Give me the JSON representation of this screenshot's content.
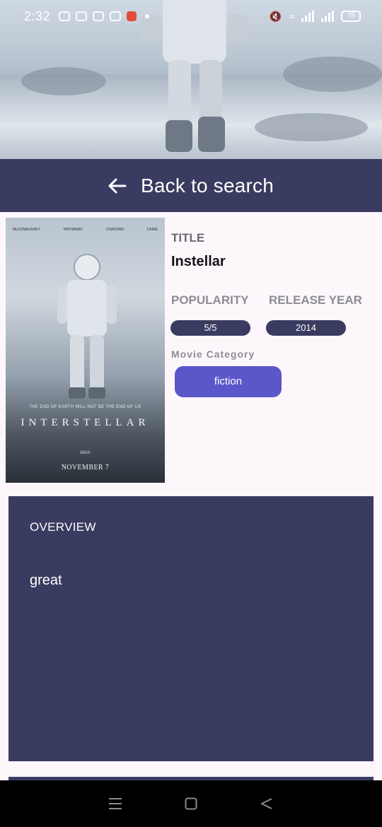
{
  "status_bar": {
    "time": "2:32",
    "battery": "78"
  },
  "header": {
    "back_label": "Back to search"
  },
  "poster": {
    "credits": [
      "McCONAUGHEY",
      "HATHAWAY",
      "CHASTAIN",
      "CAINE"
    ],
    "tagline": "THE END OF EARTH WILL NOT BE THE END OF US",
    "title": "INTERSTELLAR",
    "imax_line": "IMAX",
    "date": "NOVEMBER 7"
  },
  "details": {
    "title_label": "TITLE",
    "title_value": "Instellar",
    "popularity_label": "POPULARITY",
    "popularity_value": "5/5",
    "release_year_label": "RELEASE YEAR",
    "release_year_value": "2014",
    "category_label": "Movie Category",
    "category_value": "fiction"
  },
  "overview": {
    "heading": "OVERVIEW",
    "text": "great"
  },
  "colors": {
    "navy": "#3a3b60",
    "accent": "#5b56c9",
    "background": "#fdf7fc"
  },
  "nav": {
    "icons": [
      "menu-icon",
      "home-square-icon",
      "back-triangle-icon"
    ]
  }
}
